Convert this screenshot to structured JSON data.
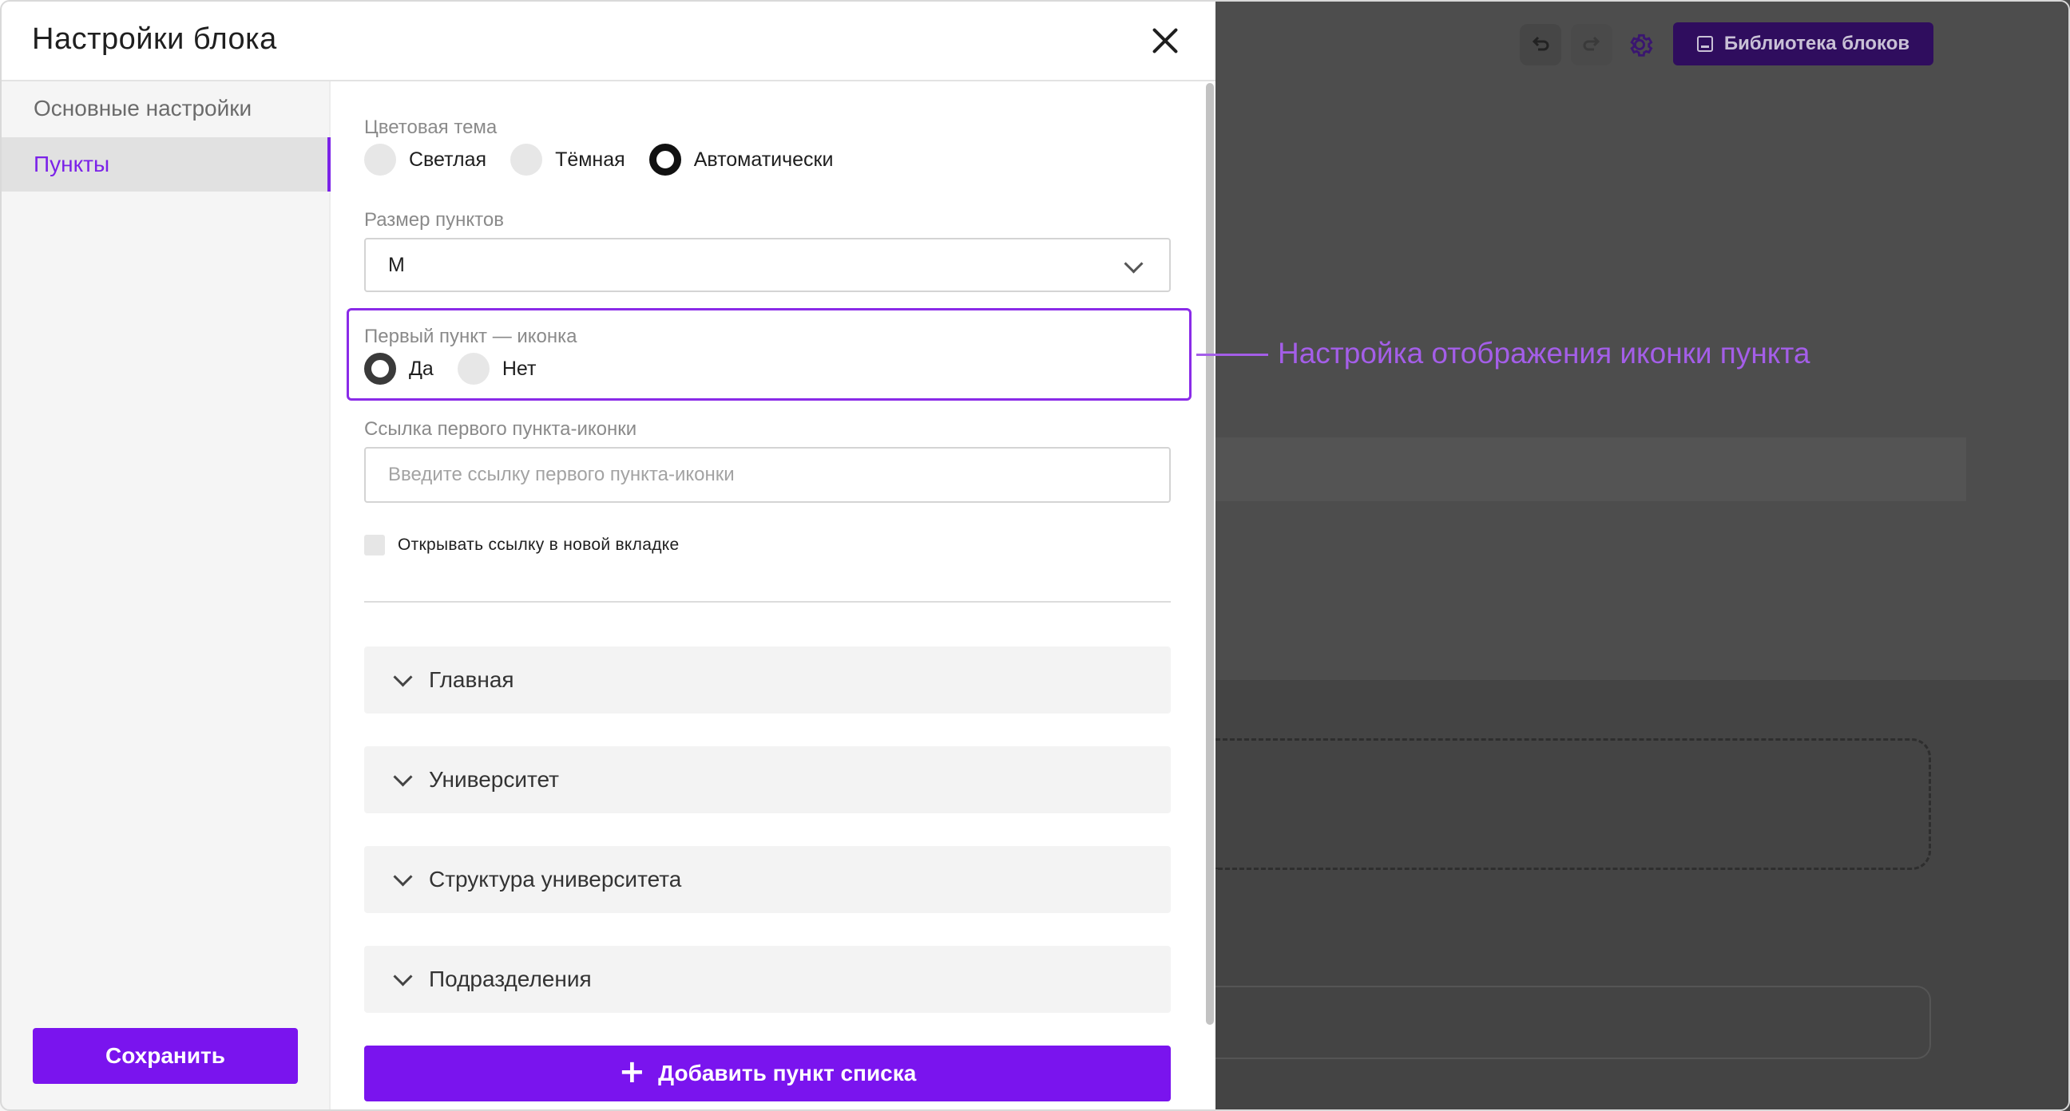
{
  "modal": {
    "title": "Настройки блока",
    "close_icon": "close-icon"
  },
  "sidebar": {
    "items": [
      {
        "label": "Основные настройки",
        "active": false
      },
      {
        "label": "Пункты",
        "active": true
      }
    ],
    "save_label": "Сохранить"
  },
  "form": {
    "theme": {
      "label": "Цветовая тема",
      "options": [
        "Светлая",
        "Тёмная",
        "Автоматически"
      ],
      "selected": "Автоматически"
    },
    "size": {
      "label": "Размер пунктов",
      "value": "M"
    },
    "first_icon": {
      "label": "Первый пункт — иконка",
      "options": [
        "Да",
        "Нет"
      ],
      "selected": "Да"
    },
    "link": {
      "label": "Ссылка первого пункта-иконки",
      "placeholder": "Введите ссылку первого пункта-иконки",
      "value": ""
    },
    "new_tab": {
      "label": "Открывать ссылку в новой вкладке",
      "checked": false
    }
  },
  "items": [
    {
      "label": "Главная"
    },
    {
      "label": "Университет"
    },
    {
      "label": "Структура университета"
    },
    {
      "label": "Подразделения"
    }
  ],
  "add_item_label": "Добавить пункт списка",
  "annotation": "Настройка отображения иконки пункта",
  "toolbar": {
    "library_label": "Библиотека блоков",
    "undo_icon": "undo-icon",
    "redo_icon": "redo-icon",
    "settings_icon": "gear-icon"
  },
  "colors": {
    "accent": "#7a14ee",
    "annotation": "#a45ee8",
    "backdrop": "#4d4d4d"
  }
}
